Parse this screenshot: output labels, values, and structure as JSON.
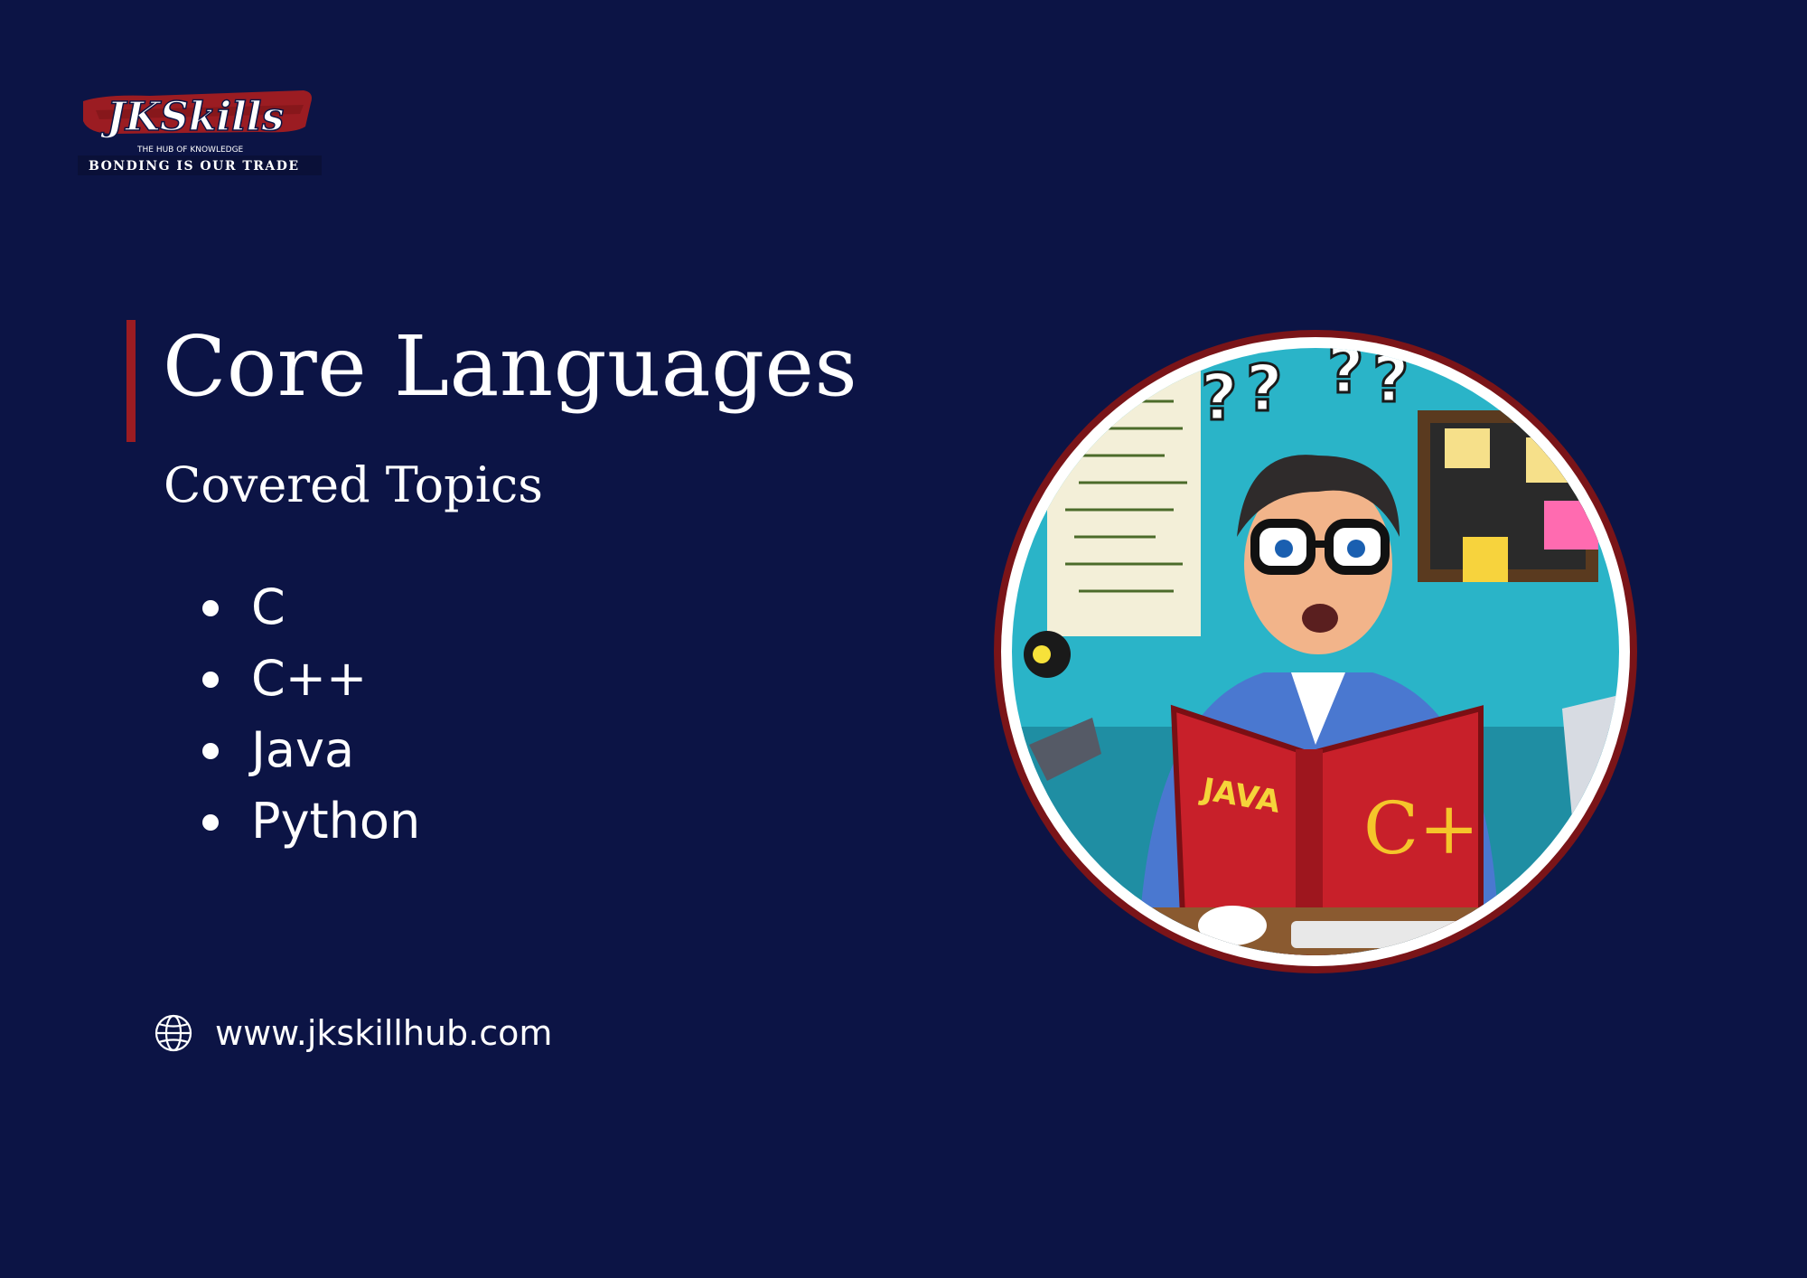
{
  "logo": {
    "brand": "JKSkills",
    "tagline_top": "THE HUB OF KNOWLEDGE",
    "tagline_bottom": "BONDING IS OUR TRADE"
  },
  "colors": {
    "background": "#0c1445",
    "accent": "#9b1c22",
    "text": "#ffffff"
  },
  "heading": {
    "title": "Core Languages",
    "subtitle": "Covered Topics"
  },
  "topics": [
    "C",
    "C++",
    "Java",
    "Python"
  ],
  "footer": {
    "icon": "globe-icon",
    "website": "www.jkskillhub.com"
  },
  "illustration": {
    "book_spine_text": "JAVA",
    "book_cover_text": "C+"
  }
}
